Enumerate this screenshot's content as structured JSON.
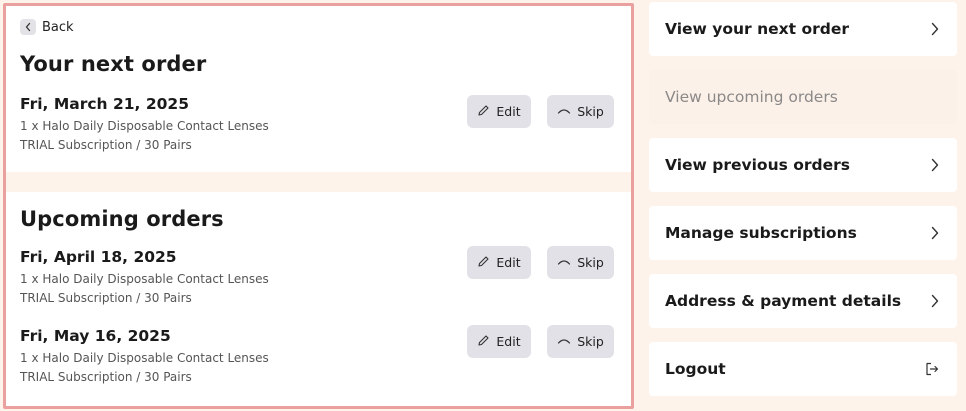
{
  "back_label": "Back",
  "next_order": {
    "title": "Your next order",
    "date": "Fri, March 21, 2025",
    "product": "1 x Halo Daily Disposable Contact Lenses",
    "subscription": "TRIAL Subscription / 30 Pairs"
  },
  "upcoming": {
    "title": "Upcoming orders",
    "orders": [
      {
        "date": "Fri, April 18, 2025",
        "product": "1 x Halo Daily Disposable Contact Lenses",
        "subscription": "TRIAL Subscription / 30 Pairs"
      },
      {
        "date": "Fri, May 16, 2025",
        "product": "1 x Halo Daily Disposable Contact Lenses",
        "subscription": "TRIAL Subscription / 30 Pairs"
      }
    ]
  },
  "actions": {
    "edit_label": "Edit",
    "skip_label": "Skip"
  },
  "nav": [
    {
      "label": "View your next order",
      "icon": "chevron-right-icon"
    },
    {
      "label": "View upcoming orders",
      "active": true
    },
    {
      "label": "View previous orders",
      "icon": "chevron-right-icon"
    },
    {
      "label": "Manage subscriptions",
      "icon": "chevron-right-icon"
    },
    {
      "label": "Address & payment details",
      "icon": "chevron-right-icon"
    },
    {
      "label": "Logout",
      "icon": "logout-icon"
    }
  ],
  "colors": {
    "page_background": "#fdf3ea",
    "highlight_border": "#e9a09f",
    "button_background": "#e1e1e7",
    "active_nav_text": "#8b8888"
  }
}
